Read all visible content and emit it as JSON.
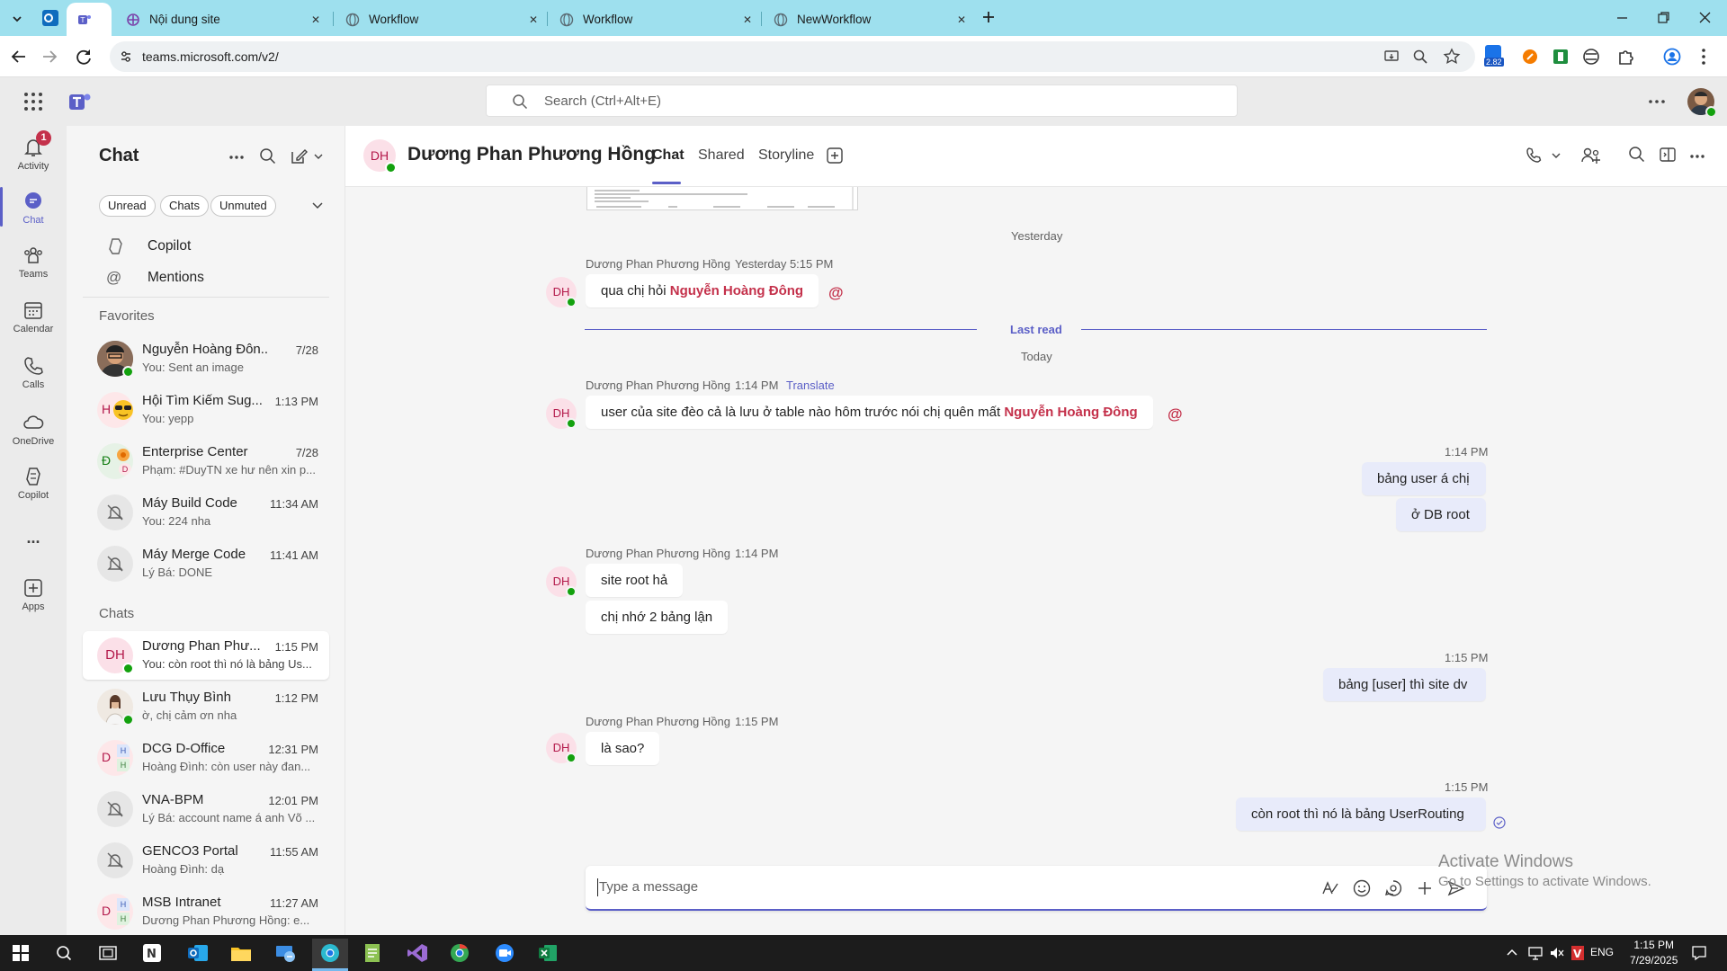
{
  "browser": {
    "tabs": [
      {
        "title": "Nội dung site"
      },
      {
        "title": "Workflow"
      },
      {
        "title": "Workflow"
      },
      {
        "title": "NewWorkflow"
      }
    ],
    "url": "teams.microsoft.com/v2/",
    "extension_badge": "2.82"
  },
  "teams": {
    "search_placeholder": "Search (Ctrl+Alt+E)"
  },
  "rail": {
    "activity": "Activity",
    "activity_badge": "1",
    "chat": "Chat",
    "teams": "Teams",
    "calendar": "Calendar",
    "calls": "Calls",
    "onedrive": "OneDrive",
    "copilot": "Copilot",
    "more": "...",
    "apps": "Apps"
  },
  "chatlist": {
    "title": "Chat",
    "filters": [
      "Unread",
      "Chats",
      "Unmuted"
    ],
    "copilot": "Copilot",
    "mentions": "Mentions",
    "favorites_label": "Favorites",
    "favorites": [
      {
        "name": "Nguyễn Hoàng Đôn...",
        "time": "7/28",
        "preview": "You: Sent an image"
      },
      {
        "name": "Hội Tìm Kiếm Sug...",
        "time": "1:13 PM",
        "preview": "You: yepp"
      },
      {
        "name": "Enterprise Center",
        "time": "7/28",
        "preview": "Phạm: #DuyTN xe hư nên xin p..."
      },
      {
        "name": "Máy Build Code",
        "time": "11:34 AM",
        "preview": "You: 224 nha"
      },
      {
        "name": "Máy Merge Code",
        "time": "11:41 AM",
        "preview": "Lý Bá: DONE"
      }
    ],
    "chats_label": "Chats",
    "chats": [
      {
        "name": "Dương Phan Phư...",
        "time": "1:15 PM",
        "preview": "You: còn root thì nó là bảng Us...",
        "initials": "DH"
      },
      {
        "name": "Lưu Thụy Bình",
        "time": "1:12 PM",
        "preview": "ờ, chị cảm ơn nha"
      },
      {
        "name": "DCG D-Office",
        "time": "12:31 PM",
        "preview": "Hoàng Đình: còn user này đan..."
      },
      {
        "name": "VNA-BPM",
        "time": "12:01 PM",
        "preview": "Lý Bá: account name á anh Võ ..."
      },
      {
        "name": "GENCO3 Portal",
        "time": "11:55 AM",
        "preview": "Hoàng Đình: dạ"
      },
      {
        "name": "MSB Intranet",
        "time": "11:27 AM",
        "preview": "Dương Phan Phương Hồng: e..."
      }
    ]
  },
  "conversation": {
    "initials": "DH",
    "name": "Dương Phan Phương Hồng",
    "tabs": [
      "Chat",
      "Shared",
      "Storyline"
    ],
    "yesterday": "Yesterday",
    "last_read": "Last read",
    "today": "Today",
    "translate": "Translate",
    "messages": [
      {
        "sender": "Dương Phan Phương Hồng",
        "time": "Yesterday 5:15 PM",
        "text": "qua chị hỏi ",
        "mention": "Nguyễn Hoàng Đông"
      },
      {
        "sender": "Dương Phan Phương Hồng",
        "time": "1:14 PM",
        "text": "user của site đèo cả là lưu ở table nào hôm trước nói chị quên mất ",
        "mention": "Nguyễn Hoàng Đông"
      },
      {
        "time": "1:14 PM",
        "lines": [
          "bảng user á chị",
          "ở DB root"
        ]
      },
      {
        "sender": "Dương Phan Phương Hồng",
        "time": "1:14 PM",
        "lines": [
          "site root hả",
          "chị nhớ 2 bảng lận"
        ]
      },
      {
        "time": "1:15 PM",
        "lines": [
          "bảng [user] thì site dv"
        ]
      },
      {
        "sender": "Dương Phan Phương Hồng",
        "time": "1:15 PM",
        "lines": [
          "là sao?"
        ]
      },
      {
        "time": "1:15 PM",
        "lines": [
          "còn root thì nó là bảng UserRouting"
        ]
      }
    ],
    "compose_placeholder": "Type a message"
  },
  "watermark": {
    "line1": "Activate Windows",
    "line2": "Go to Settings to activate Windows."
  },
  "taskbar": {
    "time": "1:15 PM",
    "date": "7/29/2025",
    "lang": "ENG"
  },
  "colors": {
    "accent": "#5b5fc7",
    "mention": "#c4314b",
    "mine_bubble": "#e8ebfa",
    "tab_strip": "#9ee0ee"
  }
}
